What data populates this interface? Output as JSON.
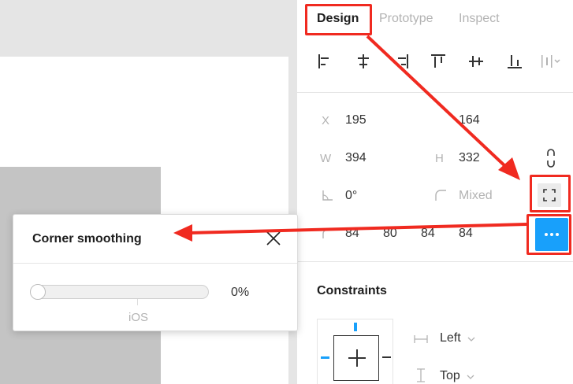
{
  "tabs": [
    {
      "label": "Design",
      "active": true
    },
    {
      "label": "Prototype",
      "active": false
    },
    {
      "label": "Inspect",
      "active": false
    }
  ],
  "alignment": [
    "align-left-icon",
    "align-horizontal-center-icon",
    "align-right-icon",
    "align-top-icon",
    "align-vertical-center-icon",
    "align-bottom-icon",
    "distribute-spacing-icon"
  ],
  "position": {
    "x_label": "X",
    "x_value": "195",
    "y_value": "164",
    "w_label": "W",
    "w_value": "394",
    "h_label": "H",
    "h_value": "332",
    "rotation_value": "0°",
    "corner_radius_value": "Mixed",
    "corners": [
      "84",
      "80",
      "84",
      "84"
    ]
  },
  "constraints": {
    "title": "Constraints",
    "horizontal": "Left",
    "vertical": "Top"
  },
  "popup": {
    "title": "Corner smoothing",
    "value": "0%",
    "preset_label": "iOS",
    "smoothing_fraction": 0
  },
  "colors": {
    "accent": "#18a0fb",
    "annotation": "#f02a20"
  }
}
